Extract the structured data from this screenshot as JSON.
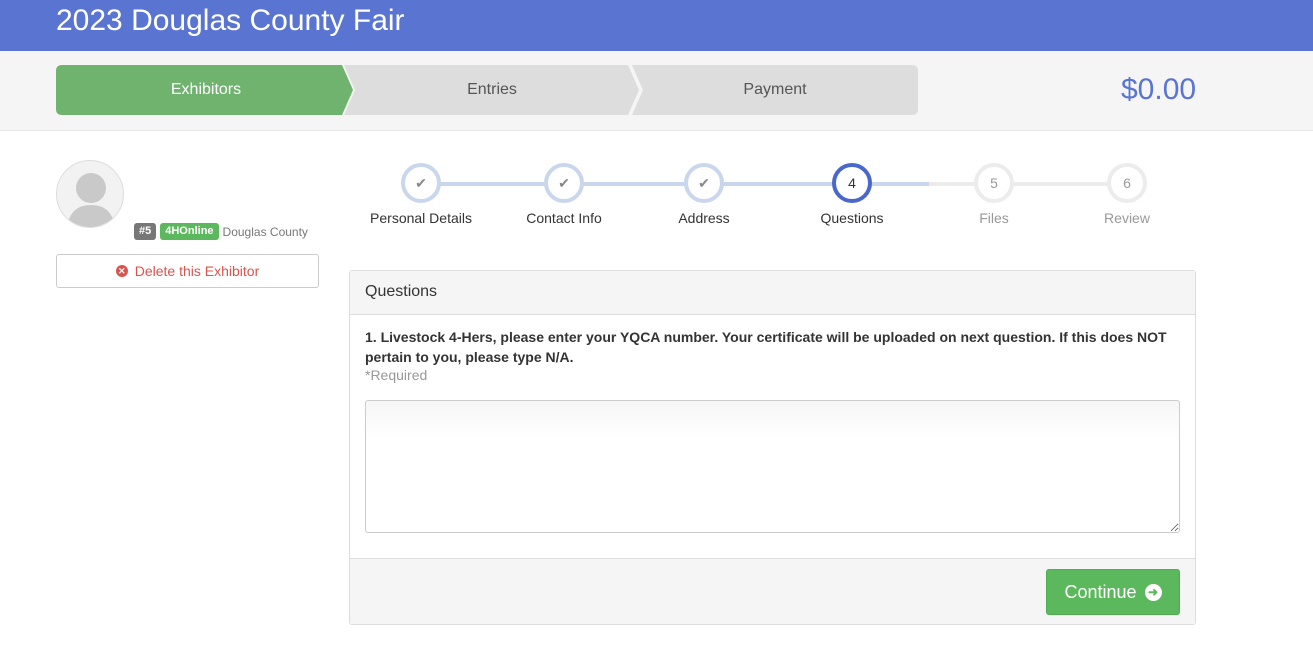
{
  "app": {
    "title": "2023 Douglas County Fair"
  },
  "wizard": {
    "steps": [
      {
        "label": "Exhibitors",
        "state": "active"
      },
      {
        "label": "Entries",
        "state": "inactive"
      },
      {
        "label": "Payment",
        "state": "inactive"
      }
    ],
    "total": "$0.00"
  },
  "exhibitor": {
    "number_badge": "#5",
    "source_badge": "4HOnline",
    "county": "Douglas County",
    "delete_label": "Delete this Exhibitor"
  },
  "progress": {
    "steps": [
      {
        "number": "",
        "label": "Personal Details",
        "state": "done"
      },
      {
        "number": "",
        "label": "Contact Info",
        "state": "done"
      },
      {
        "number": "",
        "label": "Address",
        "state": "done"
      },
      {
        "number": "4",
        "label": "Questions",
        "state": "active"
      },
      {
        "number": "5",
        "label": "Files",
        "state": "todo"
      },
      {
        "number": "6",
        "label": "Review",
        "state": "todo"
      }
    ]
  },
  "questions": {
    "heading": "Questions",
    "question_text": "1. Livestock 4-Hers, please enter your YQCA number. Your certificate will be uploaded on next question. If this does NOT pertain to you, please type N/A.",
    "required_note": "*Required",
    "answer_value": "",
    "continue_label": "Continue"
  },
  "colors": {
    "brand": "#5a75d1",
    "active_step": "#6fb36f",
    "inactive_step": "#dddddd",
    "success": "#5cb85c",
    "danger": "#d9534f"
  }
}
